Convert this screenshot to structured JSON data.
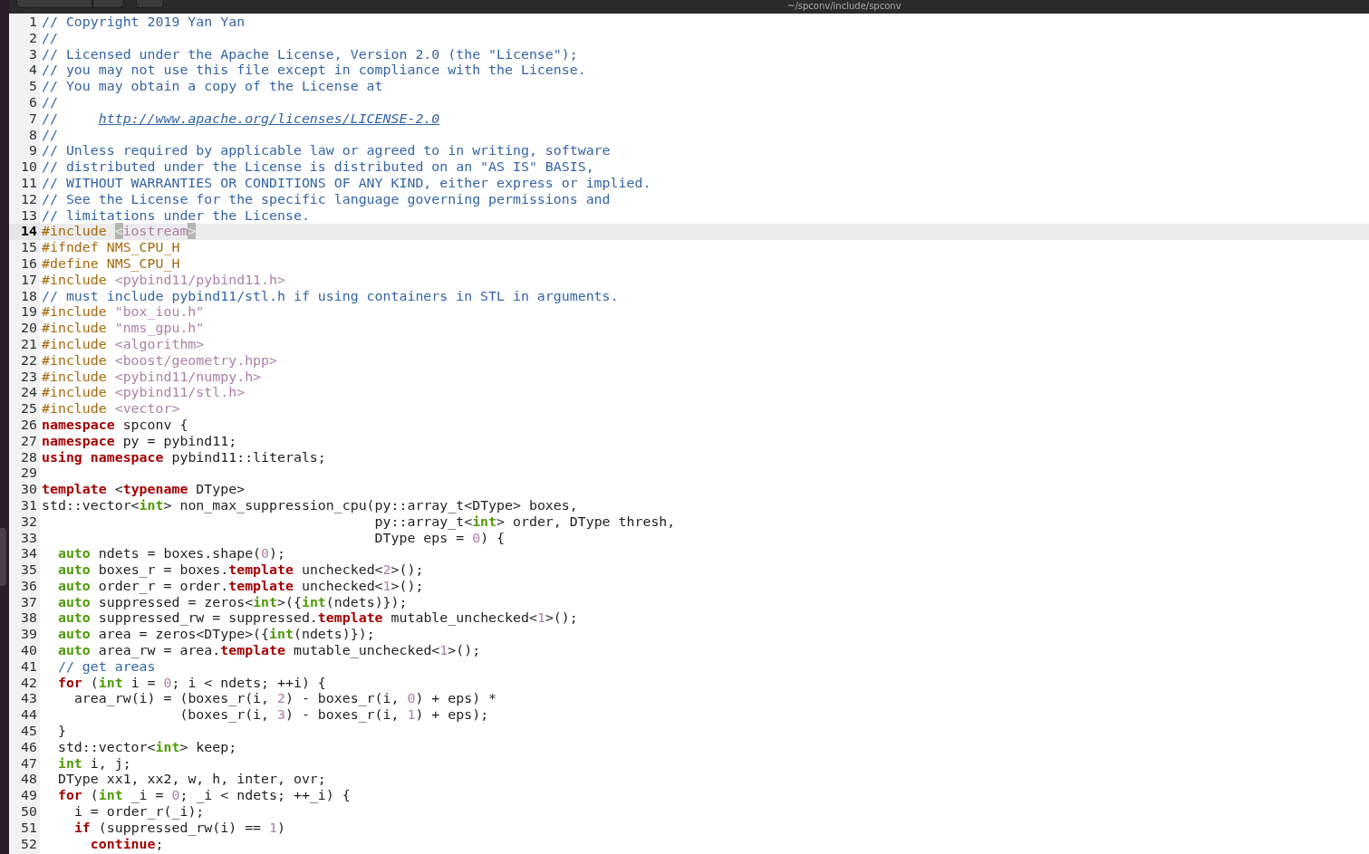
{
  "window": {
    "title": "~/spconv/include/spconv"
  },
  "editor": {
    "lines": [
      {
        "number": "1",
        "current": false,
        "tokens": [
          {
            "kind": "comment",
            "text": "// Copyright 2019 Yan Yan"
          }
        ]
      },
      {
        "number": "2",
        "current": false,
        "tokens": [
          {
            "kind": "comment",
            "text": "//"
          }
        ]
      },
      {
        "number": "3",
        "current": false,
        "tokens": [
          {
            "kind": "comment",
            "text": "// Licensed under the Apache License, Version 2.0 (the \"License\");"
          }
        ]
      },
      {
        "number": "4",
        "current": false,
        "tokens": [
          {
            "kind": "comment",
            "text": "// you may not use this file except in compliance with the License."
          }
        ]
      },
      {
        "number": "5",
        "current": false,
        "tokens": [
          {
            "kind": "comment",
            "text": "// You may obtain a copy of the License at"
          }
        ]
      },
      {
        "number": "6",
        "current": false,
        "tokens": [
          {
            "kind": "comment",
            "text": "//"
          }
        ]
      },
      {
        "number": "7",
        "current": false,
        "tokens": [
          {
            "kind": "comment",
            "text": "//     "
          },
          {
            "kind": "link",
            "text": "http://www.apache.org/licenses/LICENSE-2.0"
          }
        ]
      },
      {
        "number": "8",
        "current": false,
        "tokens": [
          {
            "kind": "comment",
            "text": "//"
          }
        ]
      },
      {
        "number": "9",
        "current": false,
        "tokens": [
          {
            "kind": "comment",
            "text": "// Unless required by applicable law or agreed to in writing, software"
          }
        ]
      },
      {
        "number": "10",
        "current": false,
        "tokens": [
          {
            "kind": "comment",
            "text": "// distributed under the License is distributed on an \"AS IS\" BASIS,"
          }
        ]
      },
      {
        "number": "11",
        "current": false,
        "tokens": [
          {
            "kind": "comment",
            "text": "// WITHOUT WARRANTIES OR CONDITIONS OF ANY KIND, either express or implied."
          }
        ]
      },
      {
        "number": "12",
        "current": false,
        "tokens": [
          {
            "kind": "comment",
            "text": "// See the License for the specific language governing permissions and"
          }
        ]
      },
      {
        "number": "13",
        "current": false,
        "tokens": [
          {
            "kind": "comment",
            "text": "// limitations under the License."
          }
        ]
      },
      {
        "number": "14",
        "current": true,
        "tokens": [
          {
            "kind": "preproc",
            "text": "#include "
          },
          {
            "kind": "bracket",
            "text": "<"
          },
          {
            "kind": "string",
            "text": "iostream"
          },
          {
            "kind": "bracket",
            "text": ">"
          }
        ]
      },
      {
        "number": "15",
        "current": false,
        "tokens": [
          {
            "kind": "preproc",
            "text": "#ifndef NMS_CPU_H"
          }
        ]
      },
      {
        "number": "16",
        "current": false,
        "tokens": [
          {
            "kind": "preproc",
            "text": "#define NMS_CPU_H"
          }
        ]
      },
      {
        "number": "17",
        "current": false,
        "tokens": [
          {
            "kind": "preproc",
            "text": "#include "
          },
          {
            "kind": "string",
            "text": "<pybind11/pybind11.h>"
          }
        ]
      },
      {
        "number": "18",
        "current": false,
        "tokens": [
          {
            "kind": "comment",
            "text": "// must include pybind11/stl.h if using containers in STL in arguments."
          }
        ]
      },
      {
        "number": "19",
        "current": false,
        "tokens": [
          {
            "kind": "preproc",
            "text": "#include "
          },
          {
            "kind": "string",
            "text": "\"box_iou.h\""
          }
        ]
      },
      {
        "number": "20",
        "current": false,
        "tokens": [
          {
            "kind": "preproc",
            "text": "#include "
          },
          {
            "kind": "string",
            "text": "\"nms_gpu.h\""
          }
        ]
      },
      {
        "number": "21",
        "current": false,
        "tokens": [
          {
            "kind": "preproc",
            "text": "#include "
          },
          {
            "kind": "string",
            "text": "<algorithm>"
          }
        ]
      },
      {
        "number": "22",
        "current": false,
        "tokens": [
          {
            "kind": "preproc",
            "text": "#include "
          },
          {
            "kind": "string",
            "text": "<boost/geometry.hpp>"
          }
        ]
      },
      {
        "number": "23",
        "current": false,
        "tokens": [
          {
            "kind": "preproc",
            "text": "#include "
          },
          {
            "kind": "string",
            "text": "<pybind11/numpy.h>"
          }
        ]
      },
      {
        "number": "24",
        "current": false,
        "tokens": [
          {
            "kind": "preproc",
            "text": "#include "
          },
          {
            "kind": "string",
            "text": "<pybind11/stl.h>"
          }
        ]
      },
      {
        "number": "25",
        "current": false,
        "tokens": [
          {
            "kind": "preproc",
            "text": "#include "
          },
          {
            "kind": "string",
            "text": "<vector>"
          }
        ]
      },
      {
        "number": "26",
        "current": false,
        "tokens": [
          {
            "kind": "keyword",
            "text": "namespace"
          },
          {
            "kind": "plain",
            "text": " spconv {"
          }
        ]
      },
      {
        "number": "27",
        "current": false,
        "tokens": [
          {
            "kind": "keyword",
            "text": "namespace"
          },
          {
            "kind": "plain",
            "text": " py = pybind11;"
          }
        ]
      },
      {
        "number": "28",
        "current": false,
        "tokens": [
          {
            "kind": "keyword",
            "text": "using namespace"
          },
          {
            "kind": "plain",
            "text": " pybind11::literals;"
          }
        ]
      },
      {
        "number": "29",
        "current": false
      },
      {
        "number": "30",
        "current": false,
        "tokens": [
          {
            "kind": "keyword",
            "text": "template"
          },
          {
            "kind": "plain",
            "text": " <"
          },
          {
            "kind": "keyword",
            "text": "typename"
          },
          {
            "kind": "plain",
            "text": " DType>"
          }
        ]
      },
      {
        "number": "31",
        "current": false,
        "tokens": [
          {
            "kind": "plain",
            "text": "std::vector<"
          },
          {
            "kind": "type",
            "text": "int"
          },
          {
            "kind": "plain",
            "text": "> non_max_suppression_cpu(py::array_t<DType> boxes,"
          }
        ]
      },
      {
        "number": "32",
        "current": false,
        "tokens": [
          {
            "kind": "plain",
            "text": "                                         py::array_t<"
          },
          {
            "kind": "type",
            "text": "int"
          },
          {
            "kind": "plain",
            "text": "> order, DType thresh,"
          }
        ]
      },
      {
        "number": "33",
        "current": false,
        "tokens": [
          {
            "kind": "plain",
            "text": "                                         DType eps = "
          },
          {
            "kind": "number",
            "text": "0"
          },
          {
            "kind": "plain",
            "text": ") {"
          }
        ]
      },
      {
        "number": "34",
        "current": false,
        "tokens": [
          {
            "kind": "type",
            "text": "  auto"
          },
          {
            "kind": "plain",
            "text": " ndets = boxes.shape("
          },
          {
            "kind": "number",
            "text": "0"
          },
          {
            "kind": "plain",
            "text": ");"
          }
        ]
      },
      {
        "number": "35",
        "current": false,
        "tokens": [
          {
            "kind": "type",
            "text": "  auto"
          },
          {
            "kind": "plain",
            "text": " boxes_r = boxes."
          },
          {
            "kind": "keyword",
            "text": "template"
          },
          {
            "kind": "plain",
            "text": " unchecked<"
          },
          {
            "kind": "number",
            "text": "2"
          },
          {
            "kind": "plain",
            "text": ">();"
          }
        ]
      },
      {
        "number": "36",
        "current": false,
        "tokens": [
          {
            "kind": "type",
            "text": "  auto"
          },
          {
            "kind": "plain",
            "text": " order_r = order."
          },
          {
            "kind": "keyword",
            "text": "template"
          },
          {
            "kind": "plain",
            "text": " unchecked<"
          },
          {
            "kind": "number",
            "text": "1"
          },
          {
            "kind": "plain",
            "text": ">();"
          }
        ]
      },
      {
        "number": "37",
        "current": false,
        "tokens": [
          {
            "kind": "type",
            "text": "  auto"
          },
          {
            "kind": "plain",
            "text": " suppressed = zeros<"
          },
          {
            "kind": "type",
            "text": "int"
          },
          {
            "kind": "plain",
            "text": ">({"
          },
          {
            "kind": "type",
            "text": "int"
          },
          {
            "kind": "plain",
            "text": "(ndets)});"
          }
        ]
      },
      {
        "number": "38",
        "current": false,
        "tokens": [
          {
            "kind": "type",
            "text": "  auto"
          },
          {
            "kind": "plain",
            "text": " suppressed_rw = suppressed."
          },
          {
            "kind": "keyword",
            "text": "template"
          },
          {
            "kind": "plain",
            "text": " mutable_unchecked<"
          },
          {
            "kind": "number",
            "text": "1"
          },
          {
            "kind": "plain",
            "text": ">();"
          }
        ]
      },
      {
        "number": "39",
        "current": false,
        "tokens": [
          {
            "kind": "type",
            "text": "  auto"
          },
          {
            "kind": "plain",
            "text": " area = zeros<DType>({"
          },
          {
            "kind": "type",
            "text": "int"
          },
          {
            "kind": "plain",
            "text": "(ndets)});"
          }
        ]
      },
      {
        "number": "40",
        "current": false,
        "tokens": [
          {
            "kind": "type",
            "text": "  auto"
          },
          {
            "kind": "plain",
            "text": " area_rw = area."
          },
          {
            "kind": "keyword",
            "text": "template"
          },
          {
            "kind": "plain",
            "text": " mutable_unchecked<"
          },
          {
            "kind": "number",
            "text": "1"
          },
          {
            "kind": "plain",
            "text": ">();"
          }
        ]
      },
      {
        "number": "41",
        "current": false,
        "tokens": [
          {
            "kind": "comment",
            "text": "  // get areas"
          }
        ]
      },
      {
        "number": "42",
        "current": false,
        "tokens": [
          {
            "kind": "keyword",
            "text": "  for"
          },
          {
            "kind": "plain",
            "text": " ("
          },
          {
            "kind": "type",
            "text": "int"
          },
          {
            "kind": "plain",
            "text": " i = "
          },
          {
            "kind": "number",
            "text": "0"
          },
          {
            "kind": "plain",
            "text": "; i < ndets; ++i) {"
          }
        ]
      },
      {
        "number": "43",
        "current": false,
        "tokens": [
          {
            "kind": "plain",
            "text": "    area_rw(i) = (boxes_r(i, "
          },
          {
            "kind": "number",
            "text": "2"
          },
          {
            "kind": "plain",
            "text": ") - boxes_r(i, "
          },
          {
            "kind": "number",
            "text": "0"
          },
          {
            "kind": "plain",
            "text": ") + eps) *"
          }
        ]
      },
      {
        "number": "44",
        "current": false,
        "tokens": [
          {
            "kind": "plain",
            "text": "                 (boxes_r(i, "
          },
          {
            "kind": "number",
            "text": "3"
          },
          {
            "kind": "plain",
            "text": ") - boxes_r(i, "
          },
          {
            "kind": "number",
            "text": "1"
          },
          {
            "kind": "plain",
            "text": ") + eps);"
          }
        ]
      },
      {
        "number": "45",
        "current": false,
        "tokens": [
          {
            "kind": "plain",
            "text": "  }"
          }
        ]
      },
      {
        "number": "46",
        "current": false,
        "tokens": [
          {
            "kind": "plain",
            "text": "  std::vector<"
          },
          {
            "kind": "type",
            "text": "int"
          },
          {
            "kind": "plain",
            "text": "> keep;"
          }
        ]
      },
      {
        "number": "47",
        "current": false,
        "tokens": [
          {
            "kind": "type",
            "text": "  int"
          },
          {
            "kind": "plain",
            "text": " i, j;"
          }
        ]
      },
      {
        "number": "48",
        "current": false,
        "tokens": [
          {
            "kind": "plain",
            "text": "  DType xx1, xx2, w, h, inter, ovr;"
          }
        ]
      },
      {
        "number": "49",
        "current": false,
        "tokens": [
          {
            "kind": "keyword",
            "text": "  for"
          },
          {
            "kind": "plain",
            "text": " ("
          },
          {
            "kind": "type",
            "text": "int"
          },
          {
            "kind": "plain",
            "text": " _i = "
          },
          {
            "kind": "number",
            "text": "0"
          },
          {
            "kind": "plain",
            "text": "; _i < ndets; ++_i) {"
          }
        ]
      },
      {
        "number": "50",
        "current": false,
        "tokens": [
          {
            "kind": "plain",
            "text": "    i = order_r(_i);"
          }
        ]
      },
      {
        "number": "51",
        "current": false,
        "tokens": [
          {
            "kind": "keyword",
            "text": "    if"
          },
          {
            "kind": "plain",
            "text": " (suppressed_rw(i) == "
          },
          {
            "kind": "number",
            "text": "1"
          },
          {
            "kind": "plain",
            "text": ")"
          }
        ]
      },
      {
        "number": "52",
        "current": false,
        "tokens": [
          {
            "kind": "keyword",
            "text": "      continue"
          },
          {
            "kind": "plain",
            "text": ";"
          }
        ]
      }
    ]
  }
}
